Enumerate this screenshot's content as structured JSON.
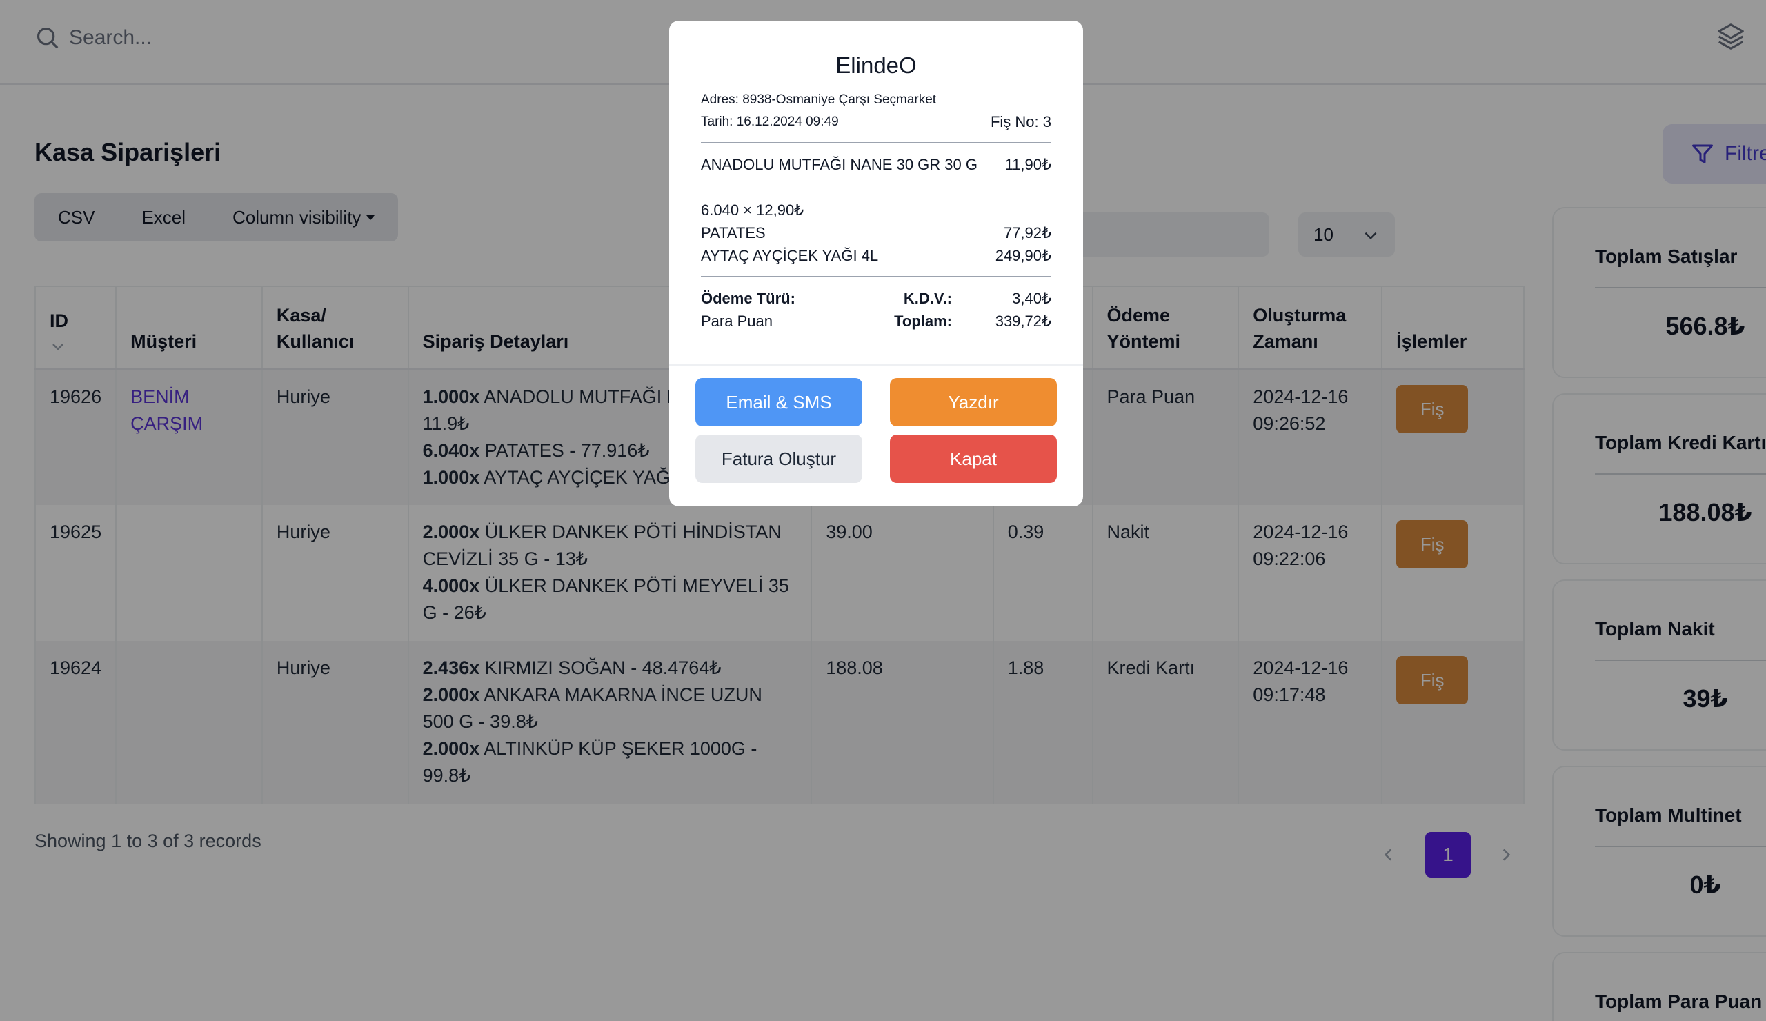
{
  "search": {
    "placeholder": "Search..."
  },
  "page": {
    "title": "Kasa Siparişleri"
  },
  "export_buttons": {
    "csv": "CSV",
    "excel": "Excel",
    "column_visibility": "Column visibility"
  },
  "page_size": "10",
  "filter_label": "Filtre",
  "table": {
    "headers": {
      "id": "ID",
      "customer": "Müşteri",
      "cashier": "Kasa/ Kullanıcı",
      "details": "Sipariş Detayları",
      "payment": "Ödeme Yöntemi",
      "created": "Oluşturma Zamanı",
      "actions": "İşlemler"
    },
    "rows": [
      {
        "id": "19626",
        "customer": "BENİM ÇARŞIM",
        "cashier": "Huriye",
        "items": [
          {
            "qty": "1.000x",
            "text": " ANADOLU MUTFAĞI NANE 30 G - 11.9₺"
          },
          {
            "qty": "6.040x",
            "text": " PATATES - 77.916₺"
          },
          {
            "qty": "1.000x",
            "text": " AYTAÇ AYÇİÇEK YAĞI 4L"
          }
        ],
        "amount": "",
        "tax": "",
        "payment": "Para Puan",
        "created": "2024-12-16 09:26:52",
        "action": "Fiş"
      },
      {
        "id": "19625",
        "customer": "",
        "cashier": "Huriye",
        "items": [
          {
            "qty": "2.000x",
            "text": " ÜLKER DANKEK PÖTİ HİNDİSTAN CEVİZLİ 35 G - 13₺"
          },
          {
            "qty": "4.000x",
            "text": " ÜLKER DANKEK PÖTİ MEYVELİ 35 G - 26₺"
          }
        ],
        "amount": "39.00",
        "tax": "0.39",
        "payment": "Nakit",
        "created": "2024-12-16 09:22:06",
        "action": "Fiş"
      },
      {
        "id": "19624",
        "customer": "",
        "cashier": "Huriye",
        "items": [
          {
            "qty": "2.436x",
            "text": " KIRMIZI SOĞAN - 48.4764₺"
          },
          {
            "qty": "2.000x",
            "text": " ANKARA MAKARNA İNCE UZUN 500 G - 39.8₺"
          },
          {
            "qty": "2.000x",
            "text": " ALTINKÜP KÜP ŞEKER 1000G - 99.8₺"
          }
        ],
        "amount": "188.08",
        "tax": "1.88",
        "payment": "Kredi Kartı",
        "created": "2024-12-16 09:17:48",
        "action": "Fiş"
      }
    ]
  },
  "records_info": "Showing 1 to 3 of 3 records",
  "pagination": {
    "current": "1"
  },
  "summary_cards": [
    {
      "title": "Toplam Satışlar",
      "value": "566.8₺"
    },
    {
      "title": "Toplam Kredi Kartı",
      "value": "188.08₺"
    },
    {
      "title": "Toplam Nakit",
      "value": "39₺"
    },
    {
      "title": "Toplam Multinet",
      "value": "0₺"
    },
    {
      "title": "Toplam Para Puan",
      "value": ""
    }
  ],
  "receipt": {
    "title": "ElindeO",
    "address": "Adres: 8938-Osmaniye Çarşı Seçmarket",
    "date": "Tarih: 16.12.2024 09:49",
    "receipt_no": "Fiş No: 3",
    "items": [
      {
        "name": "ANADOLU MUTFAĞI NANE 30 GR 30 G",
        "price": "11,90₺"
      },
      {
        "name": "6.040 × 12,90₺",
        "price": ""
      },
      {
        "name": "PATATES",
        "price": "77,92₺"
      },
      {
        "name": "AYTAÇ AYÇİÇEK YAĞI 4L",
        "price": "249,90₺"
      }
    ],
    "payment_type_label": "Ödeme Türü:",
    "payment_type_value": "Para Puan",
    "kdv_label": "K.D.V.:",
    "kdv_value": "3,40₺",
    "total_label": "Toplam:",
    "total_value": "339,72₺",
    "buttons": {
      "email_sms": "Email & SMS",
      "print": "Yazdır",
      "invoice": "Fatura Oluştur",
      "close": "Kapat"
    }
  }
}
